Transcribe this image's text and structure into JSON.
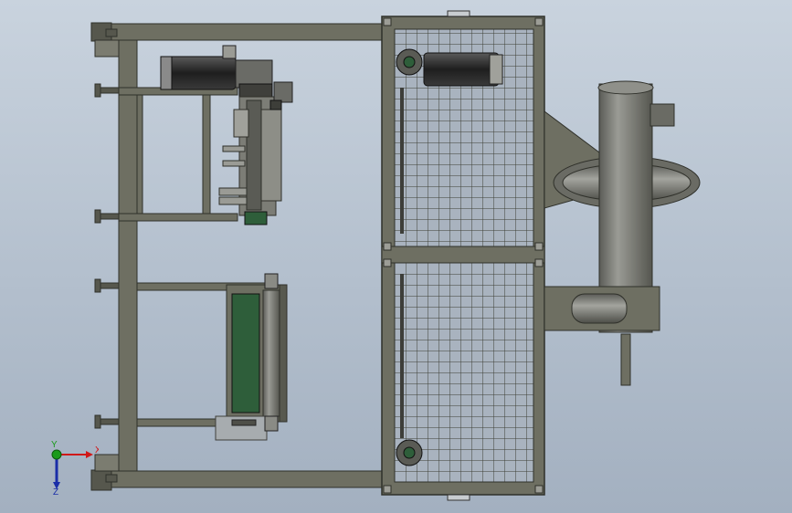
{
  "viewport": {
    "background_top": "#c9d3de",
    "background_bottom": "#a3b0c0"
  },
  "colors": {
    "frame": "#6e6f62",
    "frame_edge": "#2f302a",
    "mesh_line": "#3d3f35",
    "motor": "#3b3b3b",
    "belt_housing": "#2e5e3a",
    "fan_casing": "#7a7b74"
  },
  "triad": {
    "x_label": "X",
    "y_label": "Y",
    "z_label": "Z",
    "x_color": "#d01818",
    "y_color": "#1a9a1a",
    "z_color": "#1a2ea8"
  }
}
